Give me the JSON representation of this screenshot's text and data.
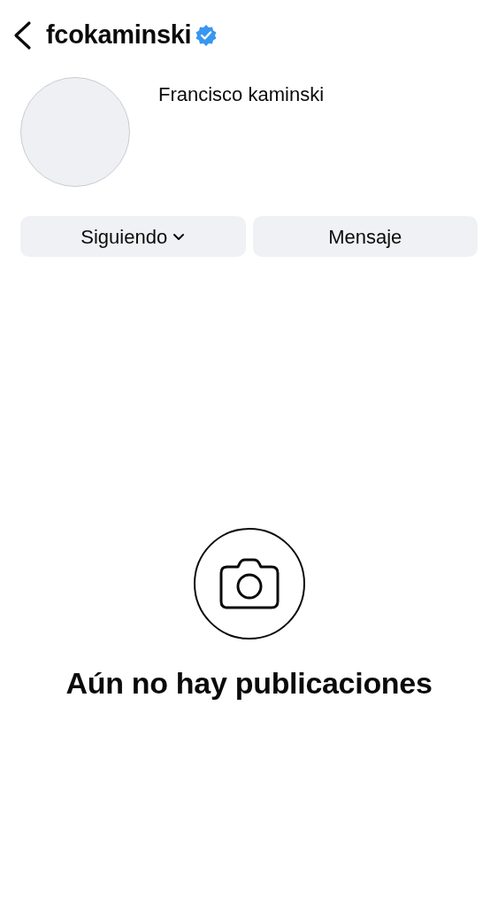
{
  "header": {
    "username": "fcokaminski",
    "verified": true
  },
  "profile": {
    "display_name": "Francisco kaminski"
  },
  "buttons": [
    {
      "label": "Siguiendo",
      "kind": "dropdown"
    },
    {
      "label": "Mensaje",
      "kind": "plain"
    }
  ],
  "empty_state": {
    "title": "Aún no hay publicaciones"
  }
}
